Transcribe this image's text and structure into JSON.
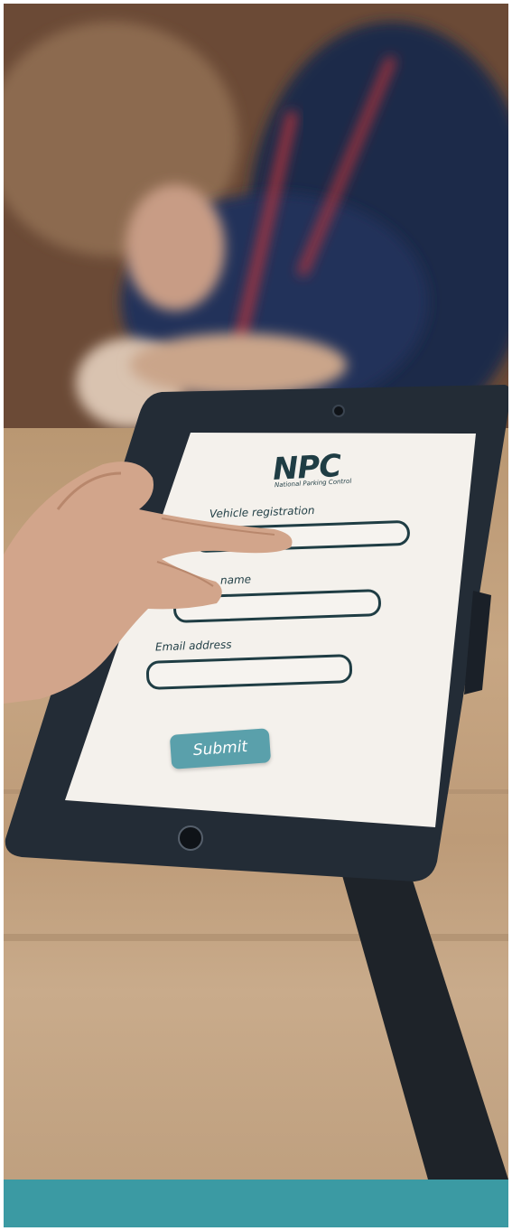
{
  "logo": {
    "text": "NPC",
    "subtitle": "National Parking Control"
  },
  "form": {
    "vehicle_label": "Vehicle registration",
    "name_label": "name",
    "email_label": "Email address",
    "submit_label": "Submit"
  },
  "colors": {
    "band": "#3b9aa3",
    "button": "#5aa0ab",
    "ink": "#1f3d44",
    "tablet": "#232c36"
  }
}
